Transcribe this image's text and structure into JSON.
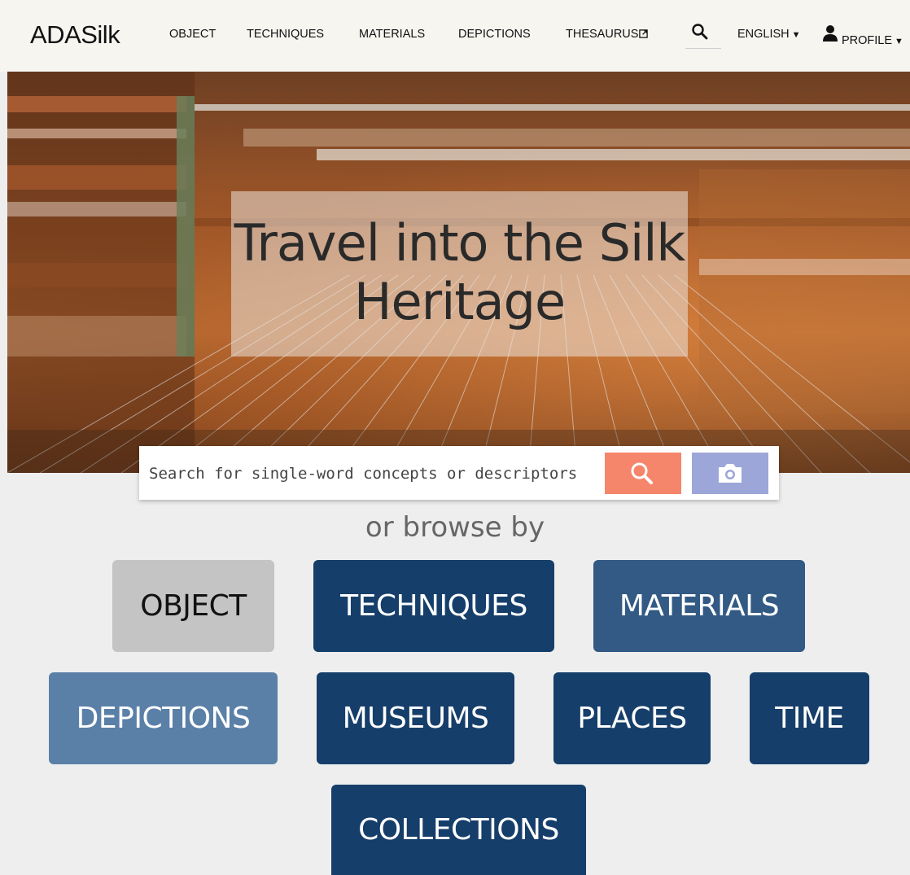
{
  "header": {
    "logo": "ADASilk",
    "nav": [
      "OBJECT",
      "TECHNIQUES",
      "MATERIALS",
      "DEPICTIONS",
      "THESAURUS"
    ],
    "language": "ENGLISH",
    "profile": "PROFILE",
    "icons": [
      "search-icon",
      "external-link-icon",
      "caret-down-icon",
      "user-icon"
    ]
  },
  "hero": {
    "title_line1": "Travel into the Silk",
    "title_line2": "Heritage"
  },
  "search": {
    "placeholder": "Search for single-word concepts or descriptors"
  },
  "browse": {
    "label": "or browse by",
    "tiles": [
      "OBJECT",
      "TECHNIQUES",
      "MATERIALS",
      "DEPICTIONS",
      "MUSEUMS",
      "PLACES",
      "TIME",
      "COLLECTIONS"
    ]
  },
  "colors": {
    "header_bg": "#f6f5f0",
    "page_bg": "#eeeeee",
    "search_button": "#f5866b",
    "camera_button": "#9da6d8",
    "tile_object": "#c4c4c4",
    "tile_dark": "#163e6a",
    "tile_mid": "#325a84",
    "tile_light": "#5a80a8"
  }
}
